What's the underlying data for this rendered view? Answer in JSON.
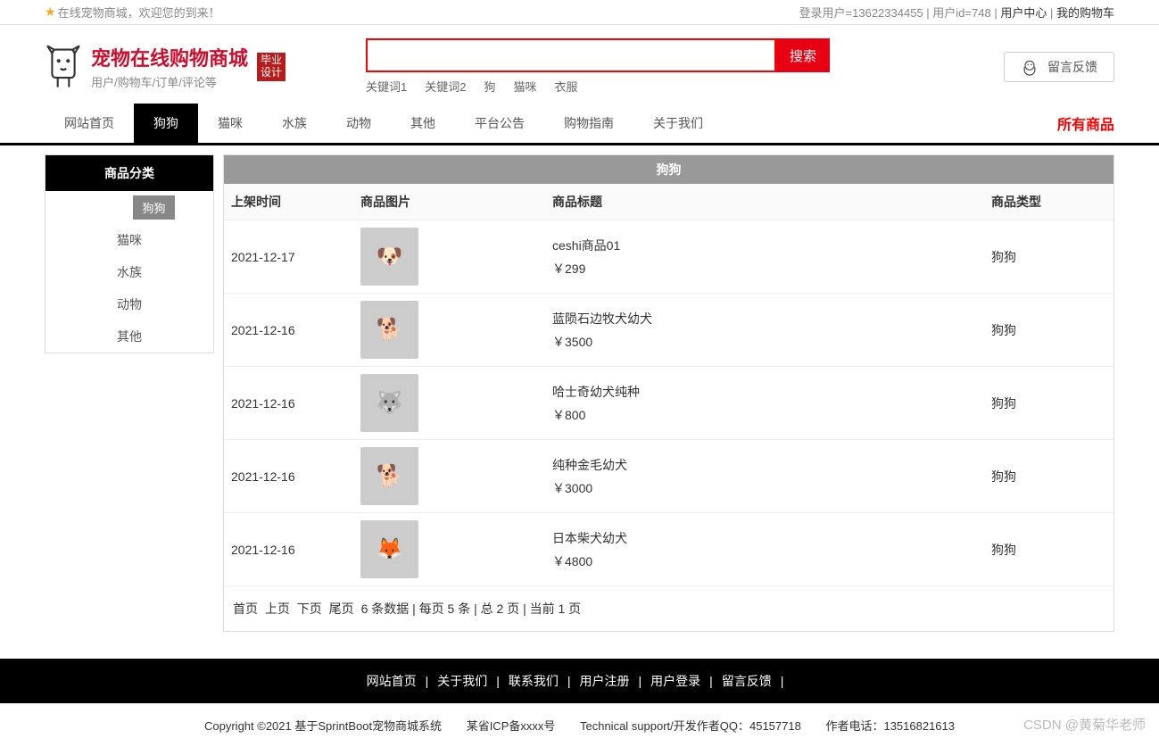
{
  "topbar": {
    "welcome": "在线宠物商城，欢迎您的到来！",
    "login_user_prefix": "登录用户=",
    "login_user": "13622334455",
    "user_id_prefix": "用户id=",
    "user_id": "748",
    "user_center": "用户中心",
    "my_cart": "我的购物车"
  },
  "logo": {
    "title": "宠物在线购物商城",
    "subtitle": "用户/购物车/订单/评论等",
    "badge_l1": "毕业",
    "badge_l2": "设计"
  },
  "search": {
    "button": "搜索",
    "keywords": [
      "关键词1",
      "关键词2",
      "狗",
      "猫咪",
      "衣服"
    ]
  },
  "feedback": "留言反馈",
  "nav": {
    "items": [
      "网站首页",
      "狗狗",
      "猫咪",
      "水族",
      "动物",
      "其他",
      "平台公告",
      "购物指南",
      "关于我们"
    ],
    "active_index": 1,
    "all": "所有商品"
  },
  "sidebar": {
    "head": "商品分类",
    "items": [
      "狗狗",
      "猫咪",
      "水族",
      "动物",
      "其他"
    ],
    "active_index": 0
  },
  "content": {
    "title": "狗狗",
    "columns": {
      "date": "上架时间",
      "image": "商品图片",
      "title": "商品标题",
      "type": "商品类型"
    },
    "rows": [
      {
        "date": "2021-12-17",
        "title": "ceshi商品01",
        "price": "￥299",
        "type": "狗狗",
        "emoji": "🐶",
        "bg": "bg1"
      },
      {
        "date": "2021-12-16",
        "title": "蓝陨石边牧犬幼犬",
        "price": "￥3500",
        "type": "狗狗",
        "emoji": "🐕",
        "bg": "bg2"
      },
      {
        "date": "2021-12-16",
        "title": "哈士奇幼犬纯种",
        "price": "￥800",
        "type": "狗狗",
        "emoji": "🐺",
        "bg": "bg3"
      },
      {
        "date": "2021-12-16",
        "title": "纯种金毛幼犬",
        "price": "￥3000",
        "type": "狗狗",
        "emoji": "🐕",
        "bg": "bg4"
      },
      {
        "date": "2021-12-16",
        "title": "日本柴犬幼犬",
        "price": "￥4800",
        "type": "狗狗",
        "emoji": "🦊",
        "bg": "bg5"
      }
    ]
  },
  "pager": {
    "first": "首页",
    "prev": "上页",
    "next": "下页",
    "last": "尾页",
    "summary": "6 条数据 | 每页 5 条 | 总 2 页 | 当前 1 页"
  },
  "footer": {
    "links": [
      "网站首页",
      "关于我们",
      "联系我们",
      "用户注册",
      "用户登录",
      "留言反馈"
    ]
  },
  "copy": {
    "c1": "Copyright ©2021 基于SprintBoot宠物商城系统",
    "c2": "某省ICP备xxxx号",
    "c3": "Technical support/开发作者QQ：45157718",
    "c4": "作者电话：13516821613"
  },
  "watermark": "CSDN @黄菊华老师"
}
